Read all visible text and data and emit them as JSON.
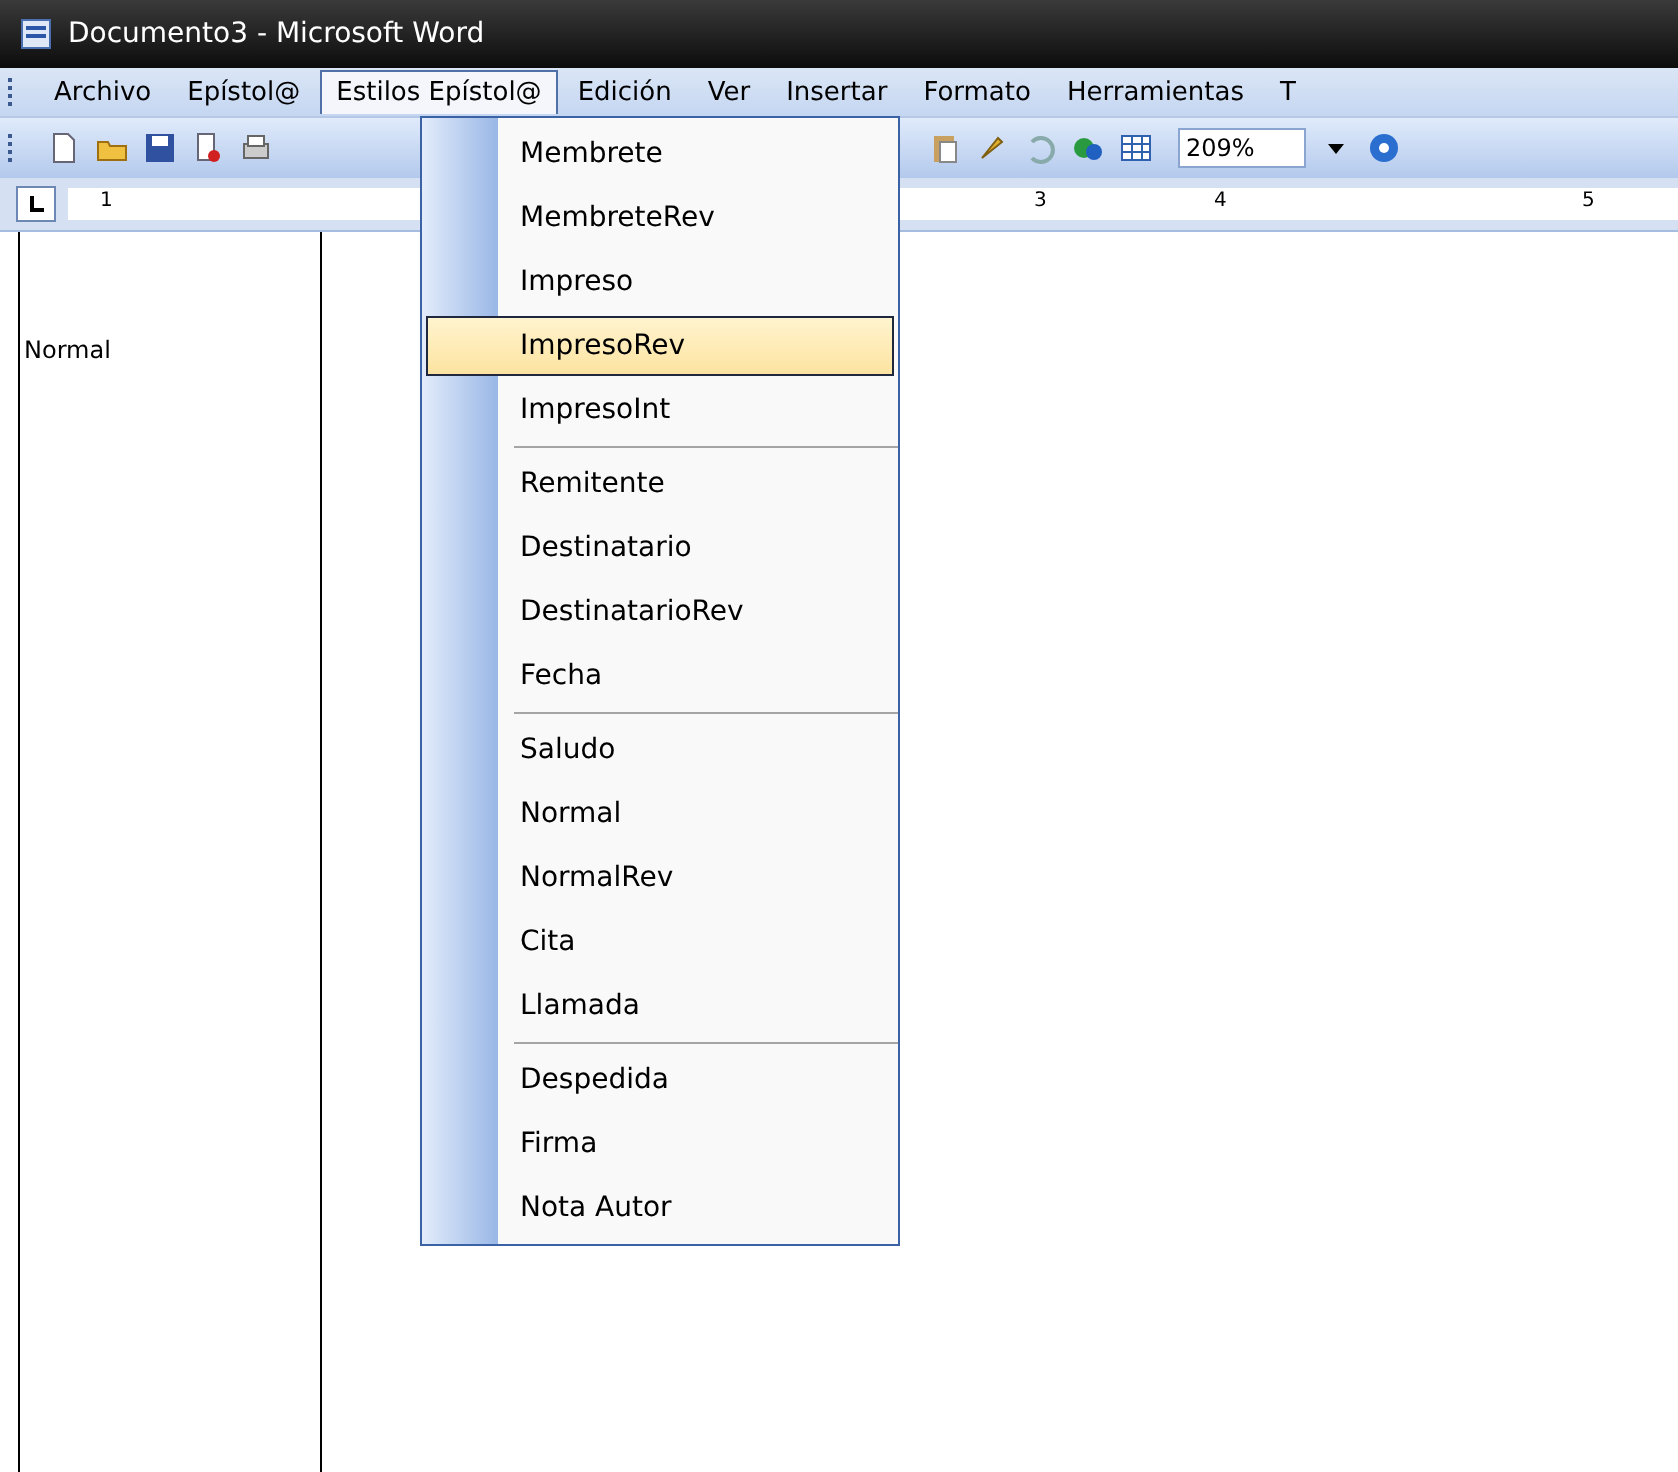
{
  "window": {
    "title": "Documento3 - Microsoft Word"
  },
  "menu_bar": [
    {
      "label": "Archivo",
      "selected": false
    },
    {
      "label": "Epístol@",
      "selected": false
    },
    {
      "label": "Estilos Epístol@",
      "selected": true
    },
    {
      "label": "Edición",
      "selected": false
    },
    {
      "label": "Ver",
      "selected": false
    },
    {
      "label": "Insertar",
      "selected": false
    },
    {
      "label": "Formato",
      "selected": false
    },
    {
      "label": "Herramientas",
      "selected": false
    },
    {
      "label": "T",
      "selected": false
    }
  ],
  "toolbar": {
    "zoom": "209%"
  },
  "ruler": {
    "numbers": [
      "1",
      "3",
      "4",
      "5"
    ]
  },
  "style_area": {
    "style_name": "Normal"
  },
  "dropdown_menu": [
    {
      "label": "Membrete",
      "selected": false,
      "separator_after": false
    },
    {
      "label": "MembreteRev",
      "selected": false,
      "separator_after": false
    },
    {
      "label": "Impreso",
      "selected": false,
      "separator_after": false
    },
    {
      "label": "ImpresoRev",
      "selected": true,
      "separator_after": false
    },
    {
      "label": "ImpresoInt",
      "selected": false,
      "separator_after": true
    },
    {
      "label": "Remitente",
      "selected": false,
      "separator_after": false
    },
    {
      "label": "Destinatario",
      "selected": false,
      "separator_after": false
    },
    {
      "label": "DestinatarioRev",
      "selected": false,
      "separator_after": false
    },
    {
      "label": "Fecha",
      "selected": false,
      "separator_after": true
    },
    {
      "label": "Saludo",
      "selected": false,
      "separator_after": false
    },
    {
      "label": "Normal",
      "selected": false,
      "separator_after": false
    },
    {
      "label": "NormalRev",
      "selected": false,
      "separator_after": false
    },
    {
      "label": "Cita",
      "selected": false,
      "separator_after": false
    },
    {
      "label": "Llamada",
      "selected": false,
      "separator_after": true
    },
    {
      "label": "Despedida",
      "selected": false,
      "separator_after": false
    },
    {
      "label": "Firma",
      "selected": false,
      "separator_after": false
    },
    {
      "label": "Nota Autor",
      "selected": false,
      "separator_after": false
    }
  ]
}
